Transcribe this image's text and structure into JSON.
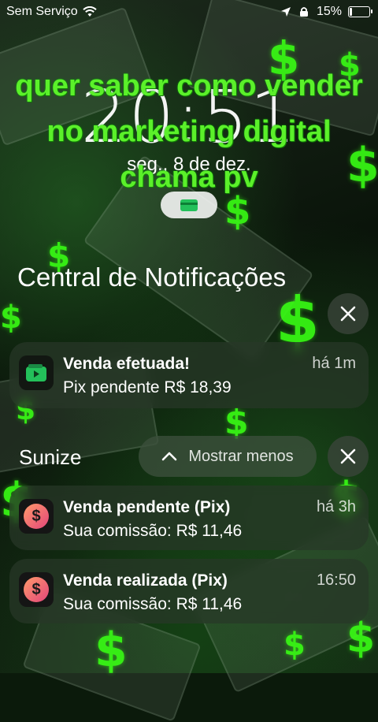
{
  "status_bar": {
    "carrier": "Sem Serviço",
    "battery": "15%",
    "battery_level": 0.15
  },
  "lockscreen": {
    "time": "20:51",
    "date": "seg., 8 de dez.",
    "overlay_caption": "quer saber como vender no marketing digital chama pv"
  },
  "notification_center": {
    "title": "Central de Notificações"
  },
  "notifications": [
    {
      "app": "wallet",
      "title": "Venda efetuada!",
      "body": "Pix pendente R$ 18,39",
      "time": "há 1m"
    }
  ],
  "groups": [
    {
      "name": "Sunize",
      "toggle_label": "Mostrar menos",
      "items": [
        {
          "title": "Venda pendente (Pix)",
          "body": "Sua comissão: R$ 11,46",
          "time": "há 3h"
        },
        {
          "title": "Venda realizada (Pix)",
          "body": "Sua comissão: R$ 11,46",
          "time": "16:50"
        }
      ]
    }
  ],
  "icons": {
    "wifi": "wifi-icon",
    "location": "location-arrow-icon",
    "lock": "orientation-lock-icon",
    "close": "close-icon",
    "chevron": "chevron-up-icon"
  },
  "colors": {
    "accent_green": "#39ff14",
    "wallet_green": "#23c05a",
    "sunize_gradient_start": "#ff9a6b",
    "sunize_gradient_end": "#e3457a"
  }
}
